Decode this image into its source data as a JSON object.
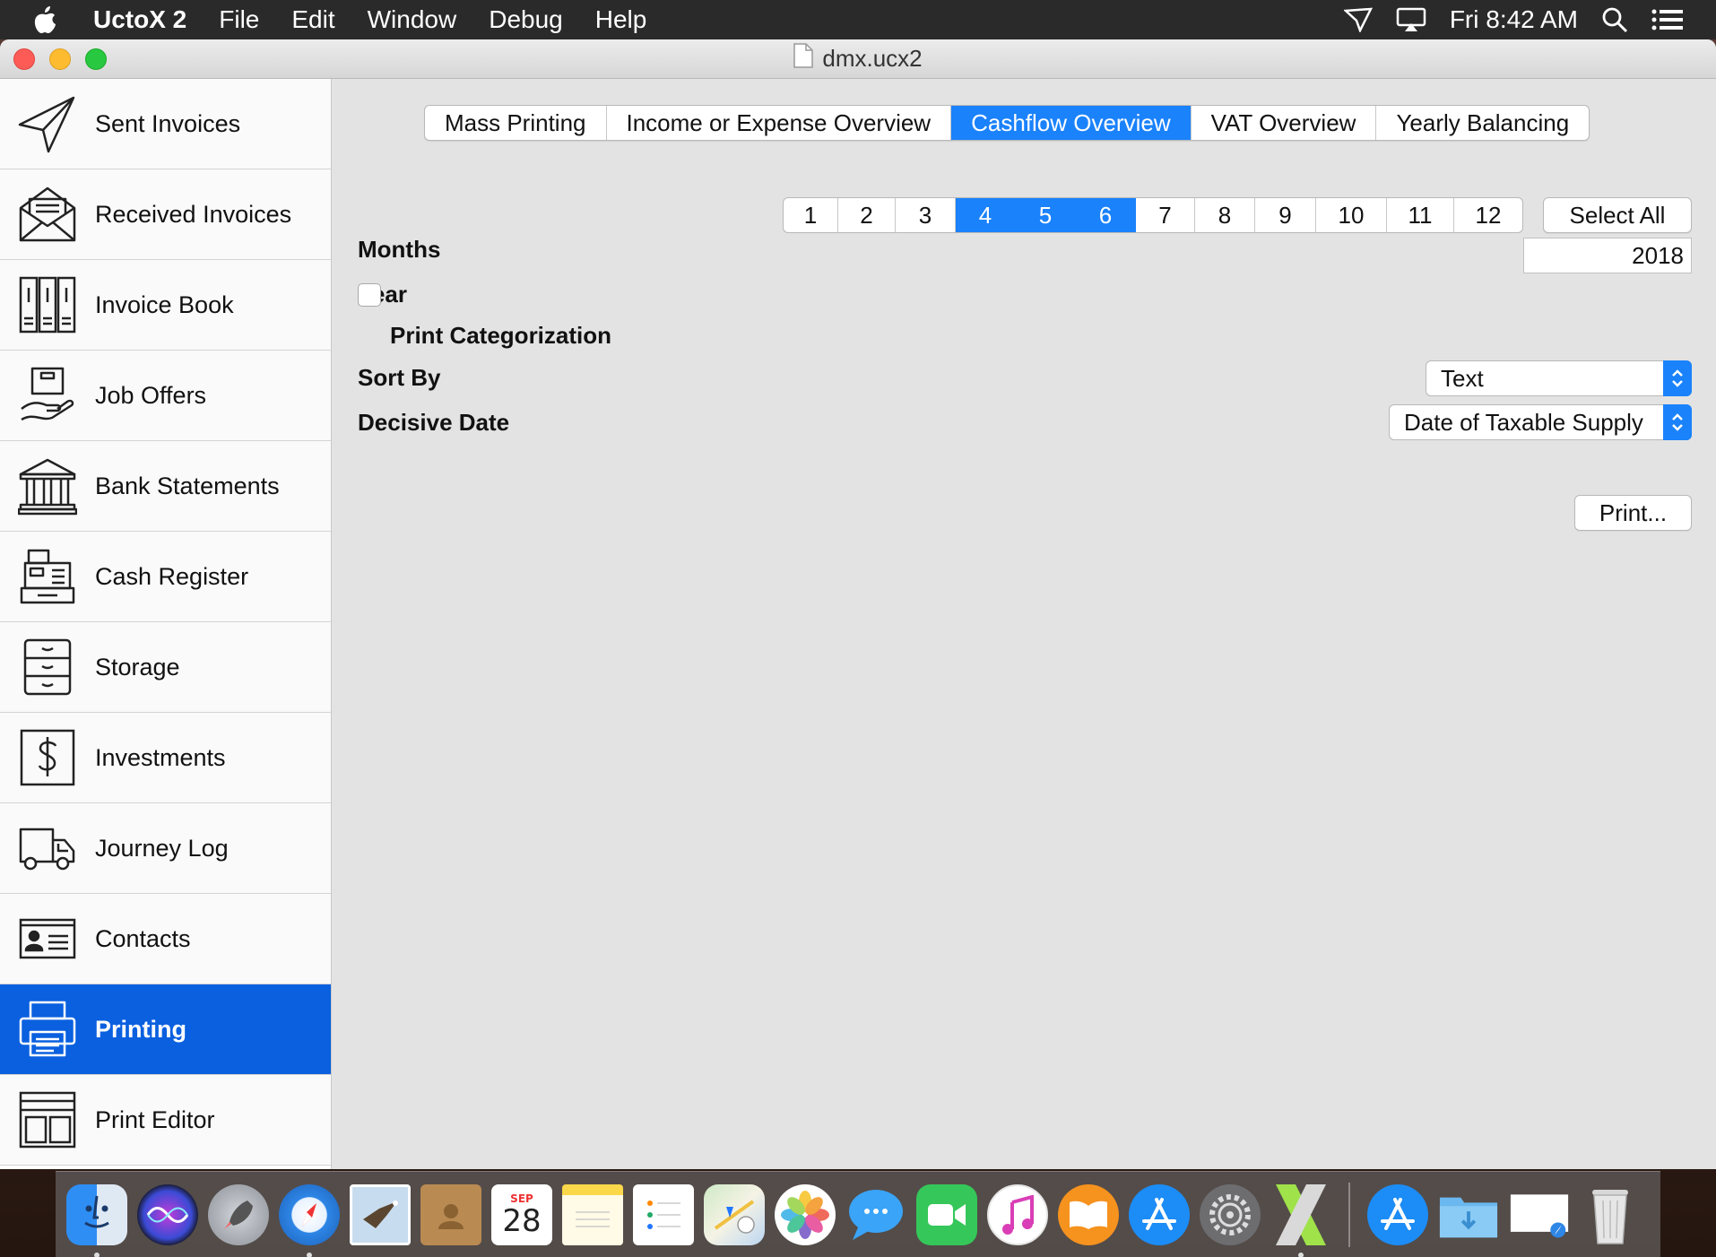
{
  "menubar": {
    "app_name": "UctoX 2",
    "menus": [
      "File",
      "Edit",
      "Window",
      "Debug",
      "Help"
    ],
    "clock": "Fri 8:42 AM"
  },
  "window": {
    "title": "dmx.ucx2"
  },
  "sidebar": {
    "items": [
      {
        "label": "Sent Invoices",
        "icon": "paper-plane-icon"
      },
      {
        "label": "Received Invoices",
        "icon": "envelope-icon"
      },
      {
        "label": "Invoice Book",
        "icon": "binders-icon"
      },
      {
        "label": "Job Offers",
        "icon": "hand-box-icon"
      },
      {
        "label": "Bank Statements",
        "icon": "bank-icon"
      },
      {
        "label": "Cash Register",
        "icon": "cash-register-icon"
      },
      {
        "label": "Storage",
        "icon": "cabinet-icon"
      },
      {
        "label": "Investments",
        "icon": "dollar-icon"
      },
      {
        "label": "Journey Log",
        "icon": "truck-icon"
      },
      {
        "label": "Contacts",
        "icon": "contact-card-icon"
      },
      {
        "label": "Printing",
        "icon": "printer-icon",
        "active": true
      },
      {
        "label": "Print Editor",
        "icon": "layout-icon"
      }
    ]
  },
  "tabs": [
    {
      "label": "Mass Printing"
    },
    {
      "label": "Income or Expense Overview"
    },
    {
      "label": "Cashflow Overview",
      "active": true
    },
    {
      "label": "VAT Overview"
    },
    {
      "label": "Yearly Balancing"
    }
  ],
  "form": {
    "months_label": "Months",
    "months": [
      "1",
      "2",
      "3",
      "4",
      "5",
      "6",
      "7",
      "8",
      "9",
      "10",
      "11",
      "12"
    ],
    "selected_months": [
      "4",
      "5",
      "6"
    ],
    "select_all_label": "Select All",
    "year_label": "Year",
    "year_value": "2018",
    "print_categorization_label": "Print Categorization",
    "print_categorization_checked": false,
    "sort_by_label": "Sort By",
    "sort_by_value": "Text",
    "decisive_date_label": "Decisive Date",
    "decisive_date_value": "Date of Taxable Supply",
    "print_button": "Print..."
  },
  "dock": {
    "calendar_month": "SEP",
    "calendar_day": "28"
  },
  "colors": {
    "accent": "#1a82fb",
    "sidebar_active": "#0a60df"
  }
}
